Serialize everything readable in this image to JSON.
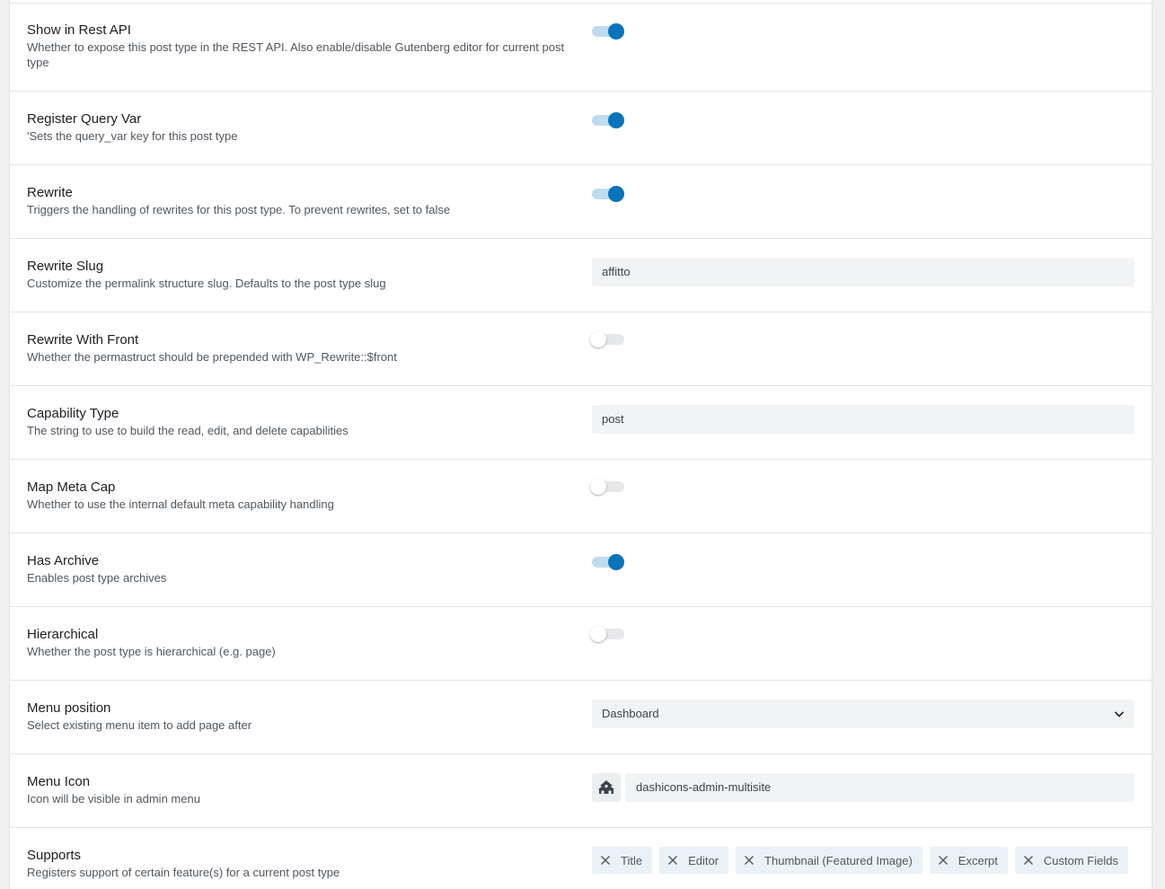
{
  "settings": {
    "show_in_rest": {
      "label": "Show in Rest API",
      "desc": "Whether to expose this post type in the REST API. Also enable/disable Gutenberg editor for current post type",
      "enabled": true
    },
    "query_var": {
      "label": "Register Query Var",
      "desc": "'Sets the query_var key for this post type",
      "enabled": true
    },
    "rewrite": {
      "label": "Rewrite",
      "desc": "Triggers the handling of rewrites for this post type. To prevent rewrites, set to false",
      "enabled": true
    },
    "rewrite_slug": {
      "label": "Rewrite Slug",
      "desc": "Customize the permalink structure slug. Defaults to the post type slug",
      "value": "affitto"
    },
    "rewrite_with_front": {
      "label": "Rewrite With Front",
      "desc": "Whether the permastruct should be prepended with WP_Rewrite::$front",
      "enabled": false
    },
    "capability_type": {
      "label": "Capability Type",
      "desc": "The string to use to build the read, edit, and delete capabilities",
      "value": "post"
    },
    "map_meta_cap": {
      "label": "Map Meta Cap",
      "desc": "Whether to use the internal default meta capability handling",
      "enabled": false
    },
    "has_archive": {
      "label": "Has Archive",
      "desc": "Enables post type archives",
      "enabled": true
    },
    "hierarchical": {
      "label": "Hierarchical",
      "desc": "Whether the post type is hierarchical (e.g. page)",
      "enabled": false
    },
    "menu_position": {
      "label": "Menu position",
      "desc": "Select existing menu item to add page after",
      "selected": "Dashboard"
    },
    "menu_icon": {
      "label": "Menu Icon",
      "desc": "Icon will be visible in admin menu",
      "value": "dashicons-admin-multisite",
      "icon": "admin-multisite-icon"
    },
    "supports": {
      "label": "Supports",
      "desc": "Registers support of certain feature(s) for a current post type",
      "items": [
        "Title",
        "Editor",
        "Thumbnail (Featured Image)",
        "Excerpt",
        "Custom Fields"
      ]
    }
  },
  "colors": {
    "accent": "#0a73b9",
    "toggle_track_on": "#bfdcef",
    "input_bg": "#f2f3f4"
  }
}
